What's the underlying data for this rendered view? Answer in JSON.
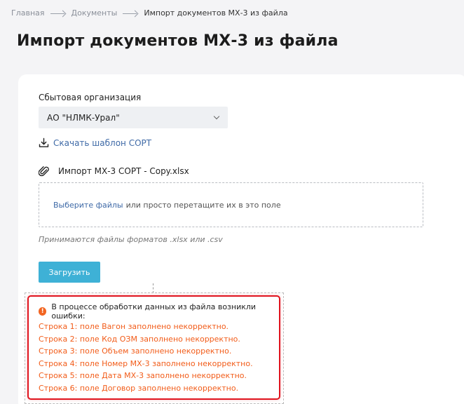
{
  "breadcrumb": {
    "home": "Главная",
    "documents": "Документы",
    "current": "Импорт документов МХ-3 из файла"
  },
  "page": {
    "title": "Импорт документов МХ-3 из файла"
  },
  "form": {
    "org_label": "Сбытовая организация",
    "org_value": "АО \"НЛМК-Урал\"",
    "download_link": "Скачать шаблон СОРТ",
    "attached_file": "Импорт МХ-3 СОРТ - Copy.xlsx",
    "dropzone_pick": "Выберите файлы",
    "dropzone_hint": "или просто перетащите их в это поле",
    "formats_note": "Принимаются файлы форматов .xlsx или .csv",
    "upload_button": "Загрузить"
  },
  "errors": {
    "header": "В процессе обработки данных из файла возникли ошибки:",
    "items": [
      "Строка 1: поле Вагон заполнено некорректно.",
      "Строка 2: поле Код ОЗМ заполнено некорректно.",
      "Строка 3: поле Объем заполнено некорректно.",
      "Строка 4: поле Номер МХ-3 заполнено некорректно.",
      "Строка 5: поле Дата МХ-3 заполнено некорректно.",
      "Строка 6: поле Договор заполнено некорректно."
    ]
  },
  "colors": {
    "accent": "#3eb1d6",
    "link": "#3f6aa7",
    "error_text": "#f25c19",
    "error_border": "#e0141e",
    "error_icon": "#f26522"
  },
  "icons": {
    "breadcrumb_separator": "arrow-right-icon",
    "select_chevron": "chevron-down-icon",
    "download": "download-icon",
    "attachment": "paperclip-icon",
    "error": "exclamation-circle-icon"
  }
}
